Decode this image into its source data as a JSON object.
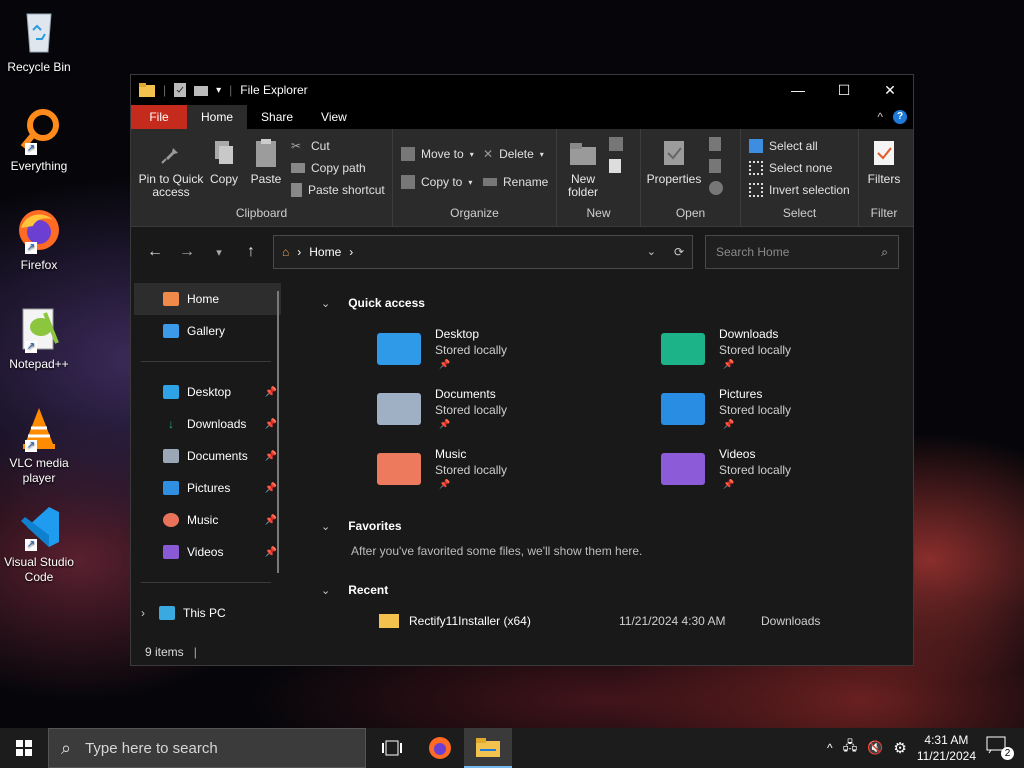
{
  "desktop": {
    "icons": [
      {
        "label": "Recycle Bin"
      },
      {
        "label": "Everything"
      },
      {
        "label": "Firefox"
      },
      {
        "label": "Notepad++"
      },
      {
        "label": "VLC media player"
      },
      {
        "label": "Visual Studio Code"
      }
    ]
  },
  "window": {
    "title": "File Explorer",
    "controls": {
      "minimize": "—",
      "maximize": "☐",
      "close": "✕"
    },
    "tabs": [
      {
        "label": "File"
      },
      {
        "label": "Home"
      },
      {
        "label": "Share"
      },
      {
        "label": "View"
      }
    ],
    "help_label": "?",
    "collapse_label": "^",
    "ribbon": {
      "clipboard": {
        "pin_label": "Pin to Quick access",
        "copy_label": "Copy",
        "paste_label": "Paste",
        "cut_label": "Cut",
        "copy_path_label": "Copy path",
        "paste_shortcut_label": "Paste shortcut",
        "group_label": "Clipboard"
      },
      "organize": {
        "move_to_label": "Move to",
        "copy_to_label": "Copy to",
        "delete_label": "Delete",
        "rename_label": "Rename",
        "group_label": "Organize"
      },
      "new": {
        "new_folder_label": "New folder",
        "group_label": "New"
      },
      "open": {
        "properties_label": "Properties",
        "group_label": "Open"
      },
      "select": {
        "select_all_label": "Select all",
        "select_none_label": "Select none",
        "invert_label": "Invert selection",
        "group_label": "Select"
      },
      "filter": {
        "filters_label": "Filters",
        "group_label": "Filter"
      }
    },
    "address": {
      "crumb": "Home",
      "search_placeholder": "Search Home"
    },
    "nav": {
      "top": [
        {
          "label": "Home"
        },
        {
          "label": "Gallery"
        }
      ],
      "pinned": [
        {
          "label": "Desktop",
          "color": "#2ea3e6"
        },
        {
          "label": "Downloads",
          "color": "#1fae73"
        },
        {
          "label": "Documents",
          "color": "#9aa7b6"
        },
        {
          "label": "Pictures",
          "color": "#2f8fe0"
        },
        {
          "label": "Music",
          "color": "#e8735a"
        },
        {
          "label": "Videos",
          "color": "#8a5ad6"
        }
      ],
      "this_pc": "This PC"
    },
    "quick_access": {
      "heading": "Quick access",
      "items": [
        {
          "name": "Desktop",
          "sub": "Stored locally",
          "color": "#2f9be8"
        },
        {
          "name": "Downloads",
          "sub": "Stored locally",
          "color": "#1db389"
        },
        {
          "name": "Documents",
          "sub": "Stored locally",
          "color": "#9fb0c4"
        },
        {
          "name": "Pictures",
          "sub": "Stored locally",
          "color": "#2a8de4"
        },
        {
          "name": "Music",
          "sub": "Stored locally",
          "color": "#ee7a5d"
        },
        {
          "name": "Videos",
          "sub": "Stored locally",
          "color": "#8c5bd8"
        }
      ]
    },
    "favorites": {
      "heading": "Favorites",
      "empty_text": "After you've favorited some files, we'll show them here."
    },
    "recent": {
      "heading": "Recent",
      "items": [
        {
          "name": "Rectify11Installer (x64)",
          "date": "11/21/2024 4:30 AM",
          "location": "Downloads"
        }
      ]
    },
    "status": {
      "count": "9 items"
    }
  },
  "taskbar": {
    "search_placeholder": "Type here to search",
    "time": "4:31 AM",
    "date": "11/21/2024",
    "notification_count": "2"
  }
}
